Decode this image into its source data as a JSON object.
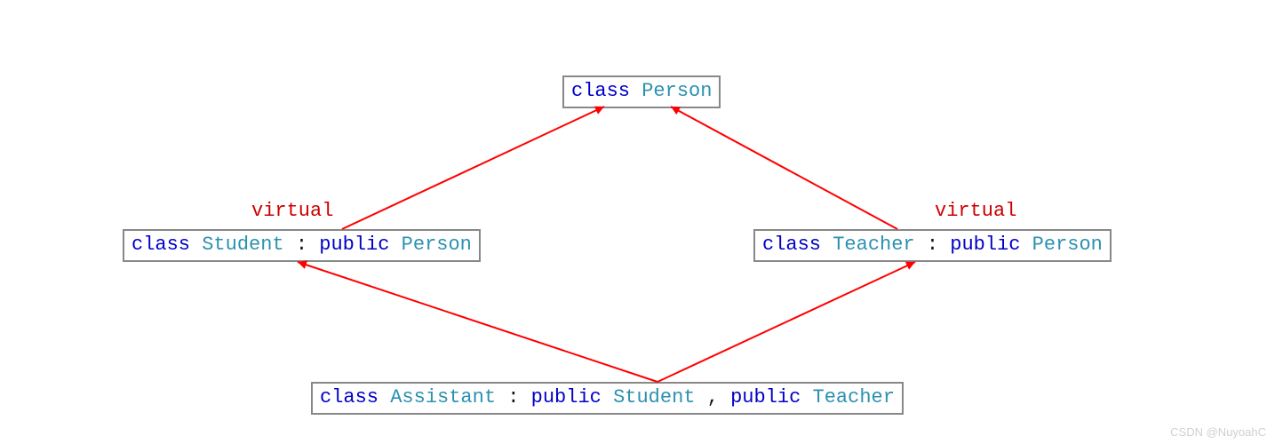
{
  "keywords": {
    "class_kw": "class",
    "public_kw": "public",
    "virtual_kw": "virtual"
  },
  "types": {
    "person": "Person",
    "student": "Student",
    "teacher": "Teacher",
    "assistant": "Assistant"
  },
  "ops": {
    "colon": " : ",
    "comma": ", "
  },
  "watermark": "CSDN @NuyoahC"
}
